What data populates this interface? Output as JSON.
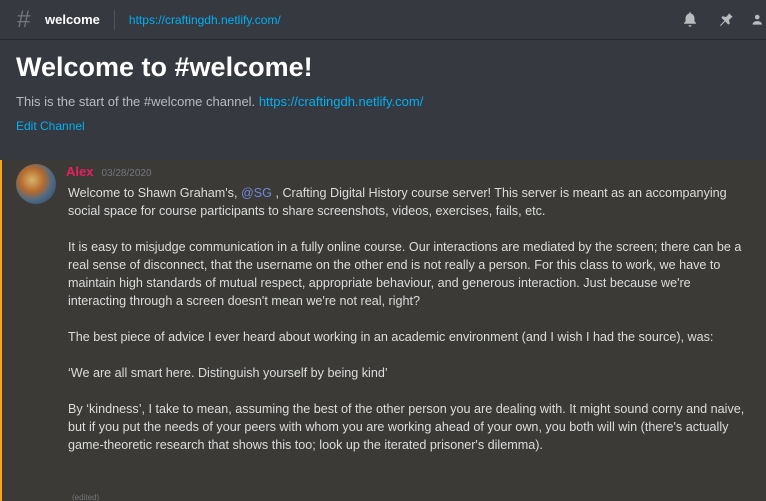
{
  "header": {
    "channel_name": "welcome",
    "topic": "https://craftingdh.netlify.com/",
    "icons": [
      "bell-icon",
      "pin-icon",
      "members-icon"
    ]
  },
  "welcome": {
    "title": "Welcome to #welcome!",
    "subtitle_prefix": "This is the start of the #welcome channel.",
    "subtitle_link": "https://craftingdh.netlify.com/",
    "edit_channel": "Edit Channel"
  },
  "message": {
    "author": "Alex",
    "author_color": "#e91e63",
    "timestamp": "03/28/2020",
    "mention": "@SG",
    "p1_before_mention": "Welcome to Shawn Graham's, ",
    "p1_after_mention": " , Crafting Digital History course server! This server is meant as an accompanying social space for course participants to share screenshots, videos, exercises, fails, etc.",
    "p2": "It is easy to misjudge communication in a fully online course. Our interactions are mediated by the screen; there can be a real sense of disconnect, that the username on the other end is not really a person. For this class to work, we have to maintain high standards of mutual respect, appropriate behaviour, and generous interaction. Just because we're interacting through a screen doesn't mean we're not real, right?",
    "p3": "The best piece of advice I ever heard about working in an academic environment (and I wish I had the source), was:",
    "p4": "‘We are all smart here. Distinguish yourself by being kind’",
    "p5": "By ‘kindness’, I take to mean, assuming the best of the other person you are dealing with. It might sound corny and naive, but if you put the needs of your peers with whom you are working ahead of your own, you both will win (there's actually game-theoretic research that shows this too; look up the iterated prisoner's dilemma).",
    "edited": "(edited)"
  },
  "colors": {
    "background": "#36393f",
    "highlight_bar": "#faa61a",
    "link": "#00b0f4",
    "mention": "#7289da"
  }
}
